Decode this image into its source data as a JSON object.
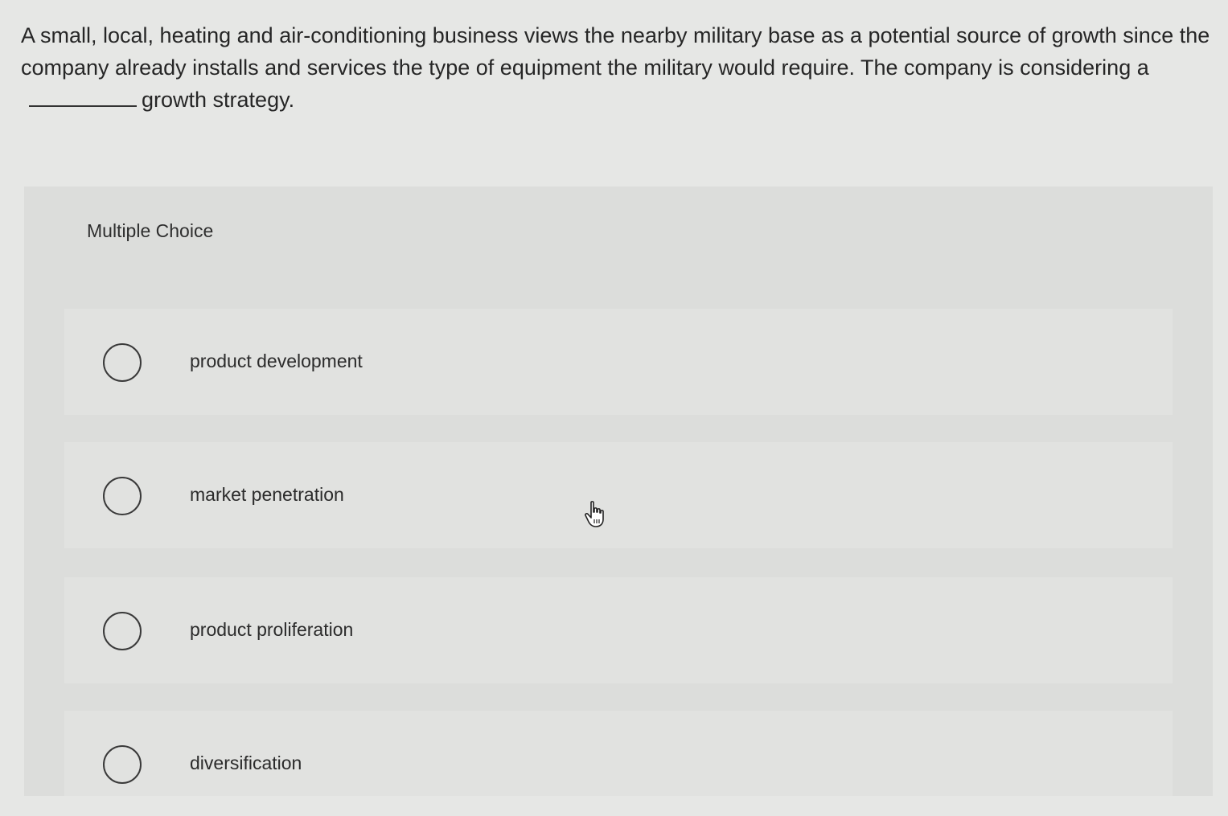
{
  "question": {
    "text_before": "A small, local, heating and air-conditioning business views the nearby military base as a potential source of growth since the company already installs and services the type of equipment the military would require. The company is considering a",
    "text_after": "growth strategy."
  },
  "panel": {
    "heading": "Multiple Choice"
  },
  "options": [
    {
      "label": "product development",
      "selected": false
    },
    {
      "label": "market penetration",
      "selected": false
    },
    {
      "label": "product proliferation",
      "selected": false
    },
    {
      "label": "diversification",
      "selected": false
    }
  ],
  "cursor": {
    "icon": "hand-pointer-icon"
  }
}
